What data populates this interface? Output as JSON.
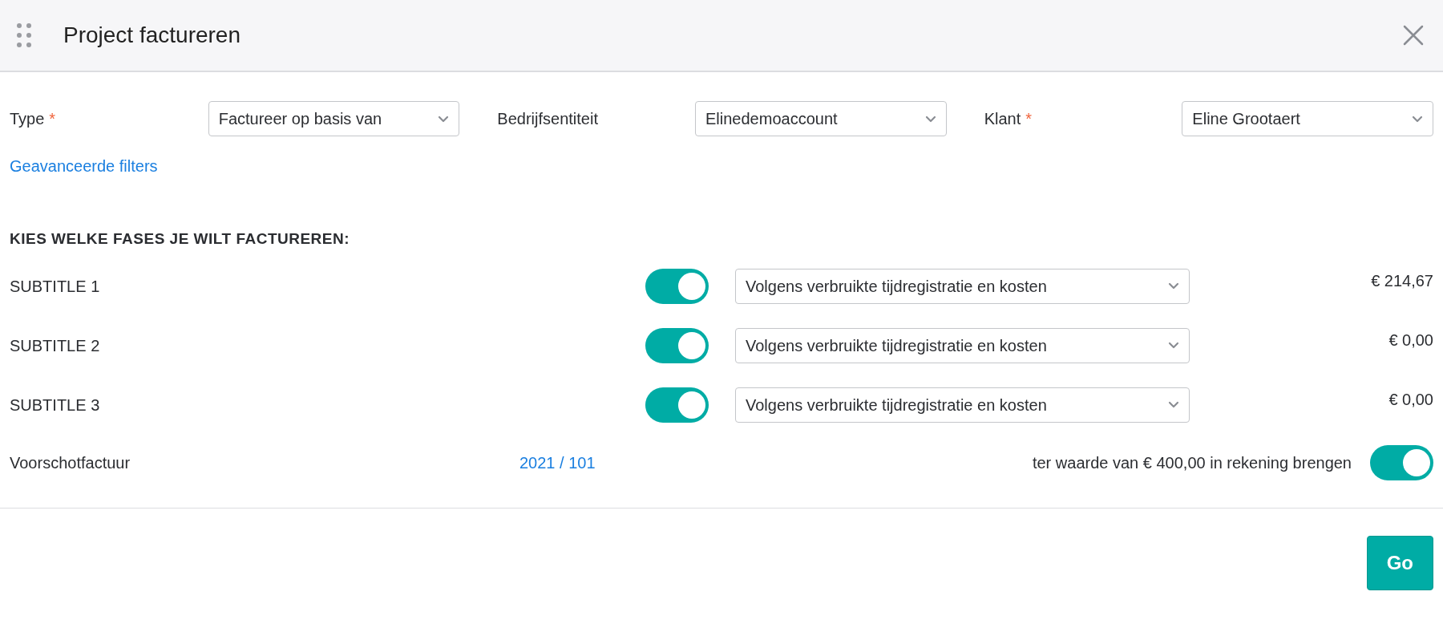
{
  "window": {
    "title": "Project factureren"
  },
  "filters": [
    {
      "label": "Type",
      "required_mark": "*",
      "value": "Factureer op basis van"
    },
    {
      "label": "Bedrijfsentiteit",
      "value": "Elinedemoaccount"
    },
    {
      "label": "Klant",
      "required_mark": "*",
      "value": "Eline Grootaert"
    }
  ],
  "advanced_link": "Geavanceerde filters",
  "section_heading": "KIES WELKE FASES JE WILT FACTUREREN:",
  "phases": [
    {
      "name": "SUBTITLE 1",
      "on": true,
      "method": "Volgens verbruikte tijdregistratie en kosten",
      "amount": "€ 214,67"
    },
    {
      "name": "SUBTITLE 2",
      "on": true,
      "method": "Volgens verbruikte tijdregistratie en kosten",
      "amount": "€ 0,00"
    },
    {
      "name": "SUBTITLE 3",
      "on": true,
      "method": "Volgens verbruikte tijdregistratie en kosten",
      "amount": "€ 0,00"
    }
  ],
  "advance_invoice": {
    "label": "Voorschotfactuur",
    "number": "2021 / 101",
    "description": "ter waarde van € 400,00 in rekening brengen",
    "on": true
  },
  "buttons": [
    "Go"
  ]
}
